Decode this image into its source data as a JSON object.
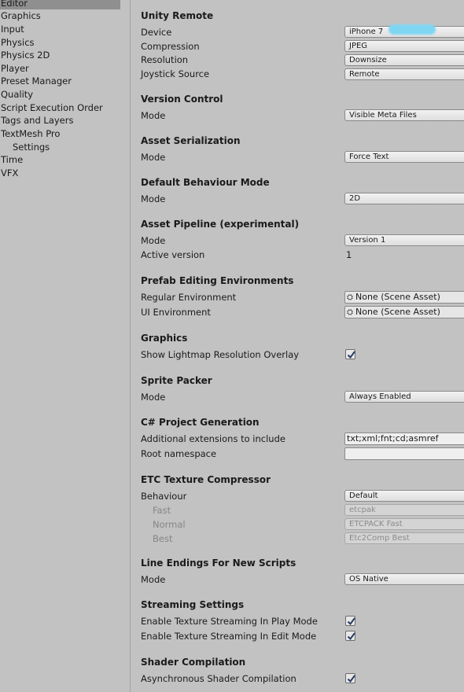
{
  "sidebar": {
    "items": [
      {
        "label": "Editor"
      },
      {
        "label": "Graphics"
      },
      {
        "label": "Input"
      },
      {
        "label": "Physics"
      },
      {
        "label": "Physics 2D"
      },
      {
        "label": "Player"
      },
      {
        "label": "Preset Manager"
      },
      {
        "label": "Quality"
      },
      {
        "label": "Script Execution Order"
      },
      {
        "label": "Tags and Layers"
      },
      {
        "label": "TextMesh Pro"
      },
      {
        "label": "Settings"
      },
      {
        "label": "Time"
      },
      {
        "label": "VFX"
      }
    ],
    "selected": "Editor"
  },
  "unity_remote": {
    "heading": "Unity Remote",
    "device_label": "Device",
    "device_value": "iPhone 7",
    "compression_label": "Compression",
    "compression_value": "JPEG",
    "resolution_label": "Resolution",
    "resolution_value": "Downsize",
    "joystick_label": "Joystick Source",
    "joystick_value": "Remote"
  },
  "version_control": {
    "heading": "Version Control",
    "mode_label": "Mode",
    "mode_value": "Visible Meta Files"
  },
  "asset_serialization": {
    "heading": "Asset Serialization",
    "mode_label": "Mode",
    "mode_value": "Force Text"
  },
  "default_behaviour": {
    "heading": "Default Behaviour Mode",
    "mode_label": "Mode",
    "mode_value": "2D"
  },
  "asset_pipeline": {
    "heading": "Asset Pipeline (experimental)",
    "mode_label": "Mode",
    "mode_value": "Version 1",
    "active_label": "Active version",
    "active_value": "1"
  },
  "prefab_editing": {
    "heading": "Prefab Editing Environments",
    "regular_label": "Regular Environment",
    "regular_value": "None (Scene Asset)",
    "ui_label": "UI Environment",
    "ui_value": "None (Scene Asset)"
  },
  "graphics": {
    "heading": "Graphics",
    "overlay_label": "Show Lightmap Resolution Overlay",
    "overlay_checked": true
  },
  "sprite_packer": {
    "heading": "Sprite Packer",
    "mode_label": "Mode",
    "mode_value": "Always Enabled"
  },
  "csharp": {
    "heading": "C# Project Generation",
    "ext_label": "Additional extensions to include",
    "ext_value": "txt;xml;fnt;cd;asmref",
    "ns_label": "Root namespace",
    "ns_value": ""
  },
  "etc": {
    "heading": "ETC Texture Compressor",
    "behaviour_label": "Behaviour",
    "behaviour_value": "Default",
    "fast_label": "Fast",
    "fast_value": "etcpak",
    "normal_label": "Normal",
    "normal_value": "ETCPACK Fast",
    "best_label": "Best",
    "best_value": "Etc2Comp Best"
  },
  "line_endings": {
    "heading": "Line Endings For New Scripts",
    "mode_label": "Mode",
    "mode_value": "OS Native"
  },
  "streaming": {
    "heading": "Streaming Settings",
    "play_label": "Enable Texture Streaming In Play Mode",
    "play_checked": true,
    "edit_label": "Enable Texture Streaming In Edit Mode",
    "edit_checked": true
  },
  "shader": {
    "heading": "Shader Compilation",
    "async_label": "Asynchronous Shader Compilation",
    "async_checked": true
  },
  "icons": {
    "checkmark": "checkmark-icon",
    "object_picker": "object-field-icon"
  },
  "colors": {
    "background": "#c2c2c2",
    "selected": "#8f8f8f",
    "checkmark": "#2b3a63"
  }
}
